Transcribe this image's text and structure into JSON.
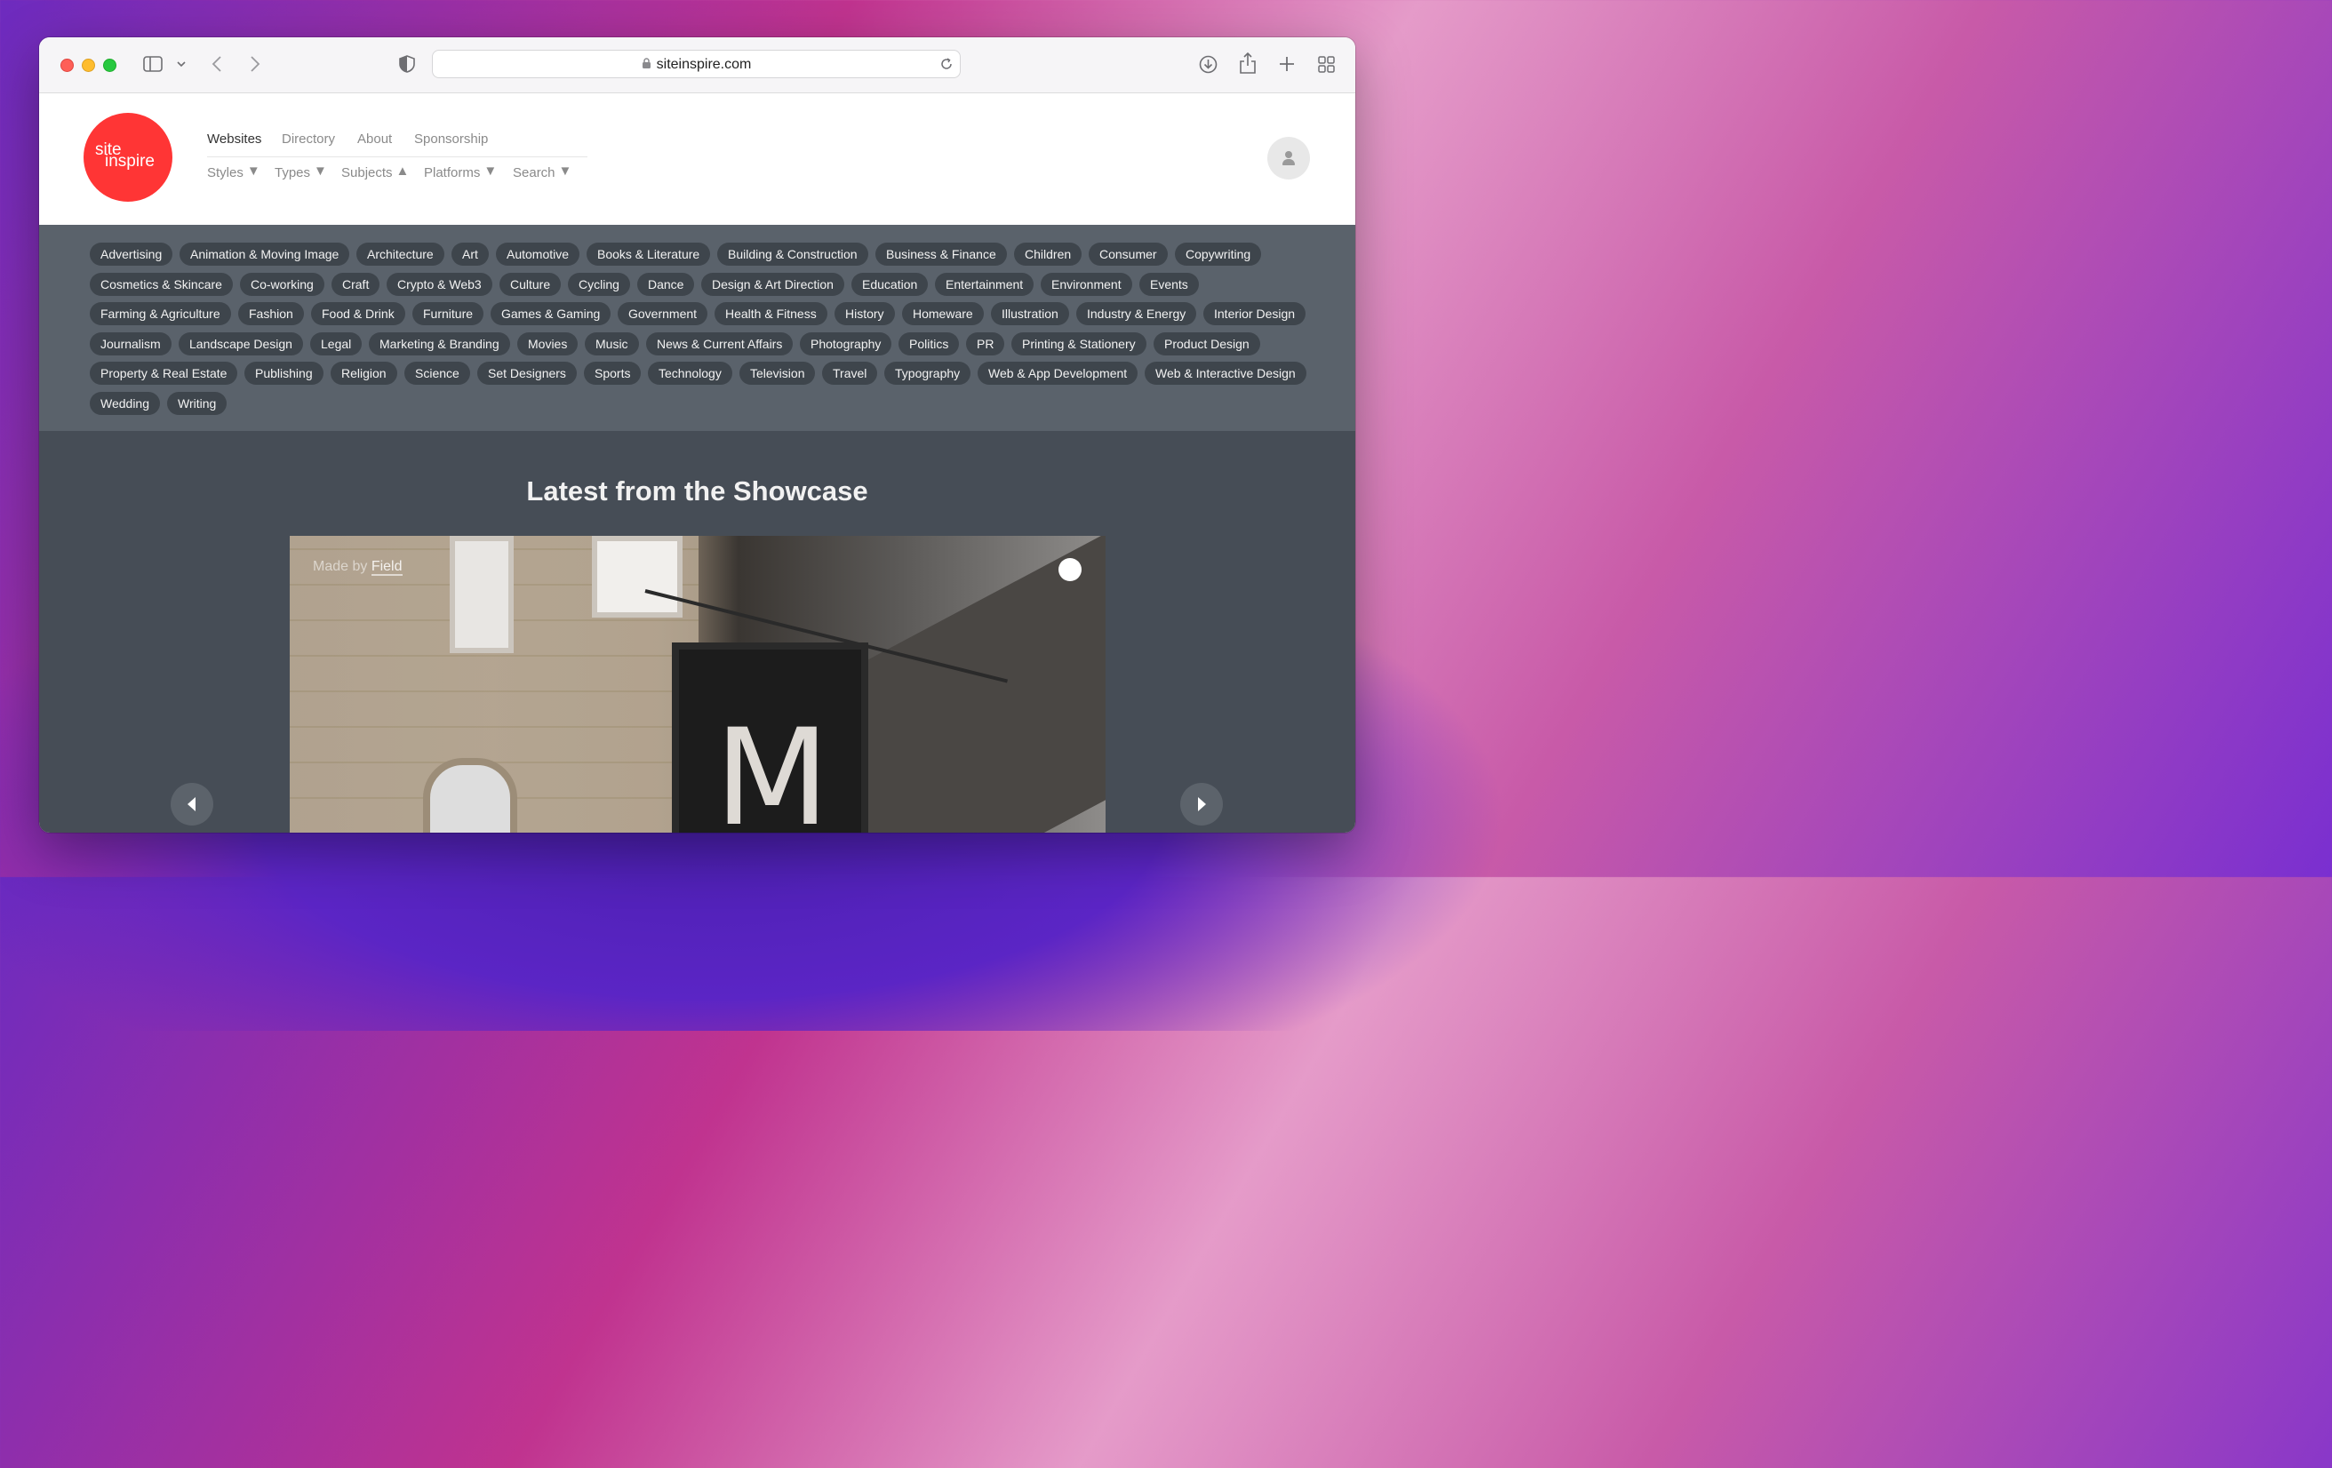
{
  "browser": {
    "url": "siteinspire.com",
    "icons": [
      "sidebar-icon",
      "chevron-down-icon",
      "back-icon",
      "forward-icon",
      "shield-icon",
      "lock-icon",
      "reload-icon",
      "download-icon",
      "share-icon",
      "new-tab-icon",
      "tab-overview-icon"
    ]
  },
  "logo": {
    "line1": "site",
    "line2": "inspire"
  },
  "nav": {
    "top": [
      "Websites",
      "Directory",
      "About",
      "Sponsorship"
    ],
    "sub": [
      "Styles",
      "Types",
      "Subjects",
      "Platforms",
      "Search"
    ]
  },
  "subjects": [
    "Advertising",
    "Animation & Moving Image",
    "Architecture",
    "Art",
    "Automotive",
    "Books & Literature",
    "Building & Construction",
    "Business & Finance",
    "Children",
    "Consumer",
    "Copywriting",
    "Cosmetics & Skincare",
    "Co-working",
    "Craft",
    "Crypto & Web3",
    "Culture",
    "Cycling",
    "Dance",
    "Design & Art Direction",
    "Education",
    "Entertainment",
    "Environment",
    "Events",
    "Farming & Agriculture",
    "Fashion",
    "Food & Drink",
    "Furniture",
    "Games & Gaming",
    "Government",
    "Health & Fitness",
    "History",
    "Homeware",
    "Illustration",
    "Industry & Energy",
    "Interior Design",
    "Journalism",
    "Landscape Design",
    "Legal",
    "Marketing & Branding",
    "Movies",
    "Music",
    "News & Current Affairs",
    "Photography",
    "Politics",
    "PR",
    "Printing & Stationery",
    "Product Design",
    "Property & Real Estate",
    "Publishing",
    "Religion",
    "Science",
    "Set Designers",
    "Sports",
    "Technology",
    "Television",
    "Travel",
    "Typography",
    "Web & App Development",
    "Web & Interactive Design",
    "Wedding",
    "Writing"
  ],
  "showcase": {
    "title": "Latest from the Showcase",
    "made_by_prefix": "Made by",
    "made_by_name": "Field",
    "sign_letter": "M"
  },
  "colors": {
    "accent": "#ff3535",
    "chip_bg": "#3e454c",
    "subjects_bg": "#5a626b",
    "showcase_bg": "#464d56"
  }
}
